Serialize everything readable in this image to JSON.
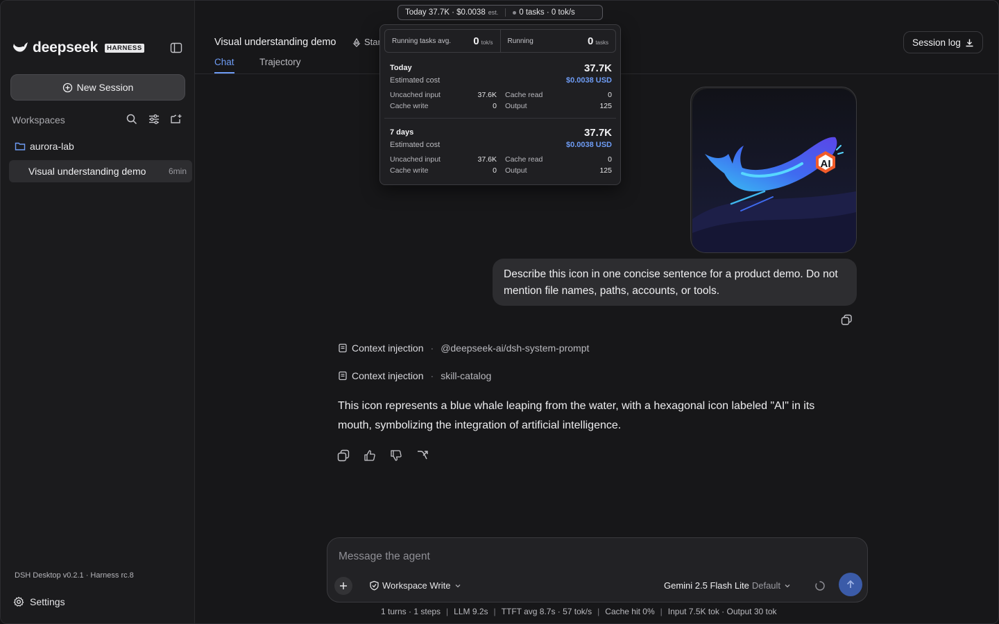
{
  "usage_pill": {
    "today": "Today 37.7K · $0.0038",
    "est": "est.",
    "tasks": "0 tasks · 0 tok/s"
  },
  "usage_popover": {
    "running_avg_label": "Running tasks avg.",
    "running_avg_value": "0",
    "running_avg_unit": "tok/s",
    "running_label": "Running",
    "running_value": "0",
    "running_unit": "tasks",
    "today": {
      "title": "Today",
      "tokens": "37.7K",
      "estimated_label": "Estimated cost",
      "cost": "$0.0038 USD",
      "uncached_input_label": "Uncached input",
      "uncached_input": "37.6K",
      "cache_read_label": "Cache read",
      "cache_read": "0",
      "cache_write_label": "Cache write",
      "cache_write": "0",
      "output_label": "Output",
      "output": "125"
    },
    "week": {
      "title": "7 days",
      "tokens": "37.7K",
      "estimated_label": "Estimated cost",
      "cost": "$0.0038 USD",
      "uncached_input_label": "Uncached input",
      "uncached_input": "37.6K",
      "cache_read_label": "Cache read",
      "cache_read": "0",
      "cache_write_label": "Cache write",
      "cache_write": "0",
      "output_label": "Output",
      "output": "125"
    }
  },
  "sidebar": {
    "brand": "deepseek",
    "brand_badge": "HARNESS",
    "new_session_label": "New Session",
    "workspaces_label": "Workspaces",
    "workspace": "aurora-lab",
    "session": {
      "title": "Visual understanding demo",
      "age": "6min"
    },
    "version": "DSH Desktop v0.2.1 · Harness rc.8",
    "settings_label": "Settings"
  },
  "header": {
    "title": "Visual understanding demo",
    "star_label": "Star",
    "tabs": [
      {
        "label": "Chat",
        "active": true
      },
      {
        "label": "Trajectory",
        "active": false
      }
    ],
    "session_log_label": "Session log"
  },
  "chat": {
    "user_message": "Describe this icon in one concise sentence for a product demo. Do not mention file names, paths, accounts, or tools.",
    "image_badge_text": "AI",
    "context": [
      {
        "label": "Context injection",
        "value": "@deepseek-ai/dsh-system-prompt"
      },
      {
        "label": "Context injection",
        "value": "skill-catalog"
      }
    ],
    "answer": "This icon represents a blue whale leaping from the water, with a hexagonal icon labeled \"AI\" in its mouth, symbolizing the integration of artificial intelligence."
  },
  "composer": {
    "placeholder": "Message the agent",
    "permission_label": "Workspace Write",
    "model_name": "Gemini 2.5 Flash Lite",
    "model_default": "Default"
  },
  "footer": {
    "turns": "1 turns · 1 steps",
    "llm": "LLM 9.2s",
    "ttft": "TTFT avg 8.7s · 57 tok/s",
    "cache": "Cache hit 0%",
    "io": "Input 7.5K tok · Output 30 tok"
  },
  "colors": {
    "accent": "#6e9cf5",
    "send_button": "#3b5ba8"
  }
}
